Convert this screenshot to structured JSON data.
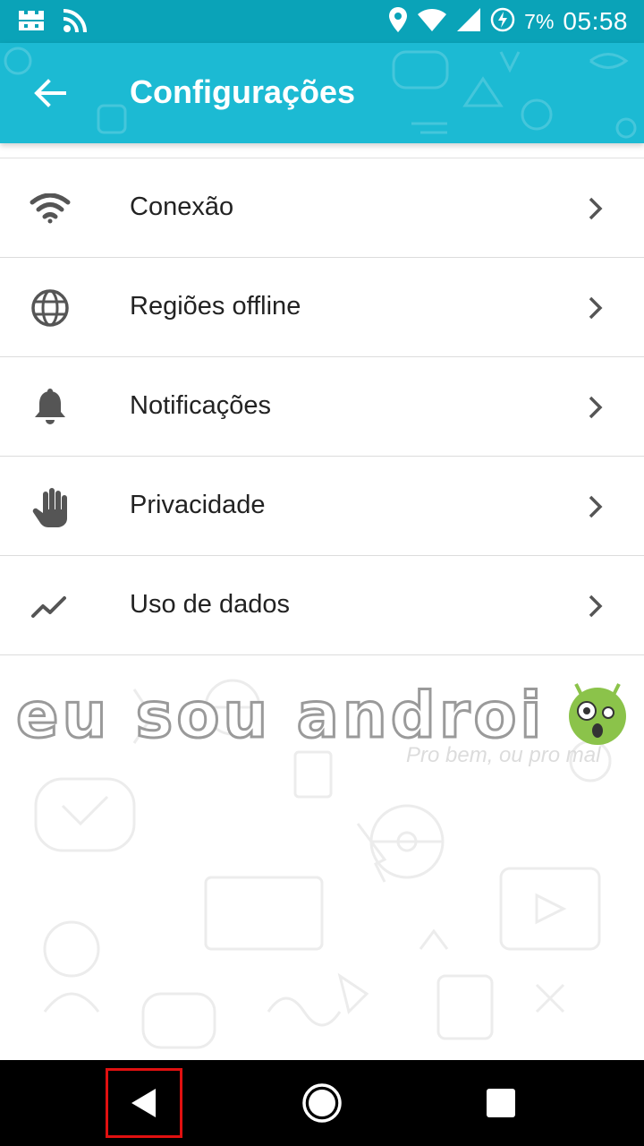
{
  "status_bar": {
    "icons_left": [
      "notification-app-icon",
      "cast-icon"
    ],
    "icons_right": [
      "location-icon",
      "wifi-icon",
      "signal-icon",
      "battery-charging-icon"
    ],
    "battery_percent": "7%",
    "time": "05:58"
  },
  "app_bar": {
    "title": "Configurações",
    "color": "#1cbad3"
  },
  "settings": {
    "items": [
      {
        "label": "Conexão",
        "icon": "wifi-icon"
      },
      {
        "label": "Regiões offline",
        "icon": "globe-icon"
      },
      {
        "label": "Notificações",
        "icon": "bell-icon"
      },
      {
        "label": "Privacidade",
        "icon": "hand-icon"
      },
      {
        "label": "Uso de dados",
        "icon": "trending-chart-icon"
      }
    ]
  },
  "watermark": {
    "brand": "eu sou androi",
    "tagline": "Pro bem, ou pro mal"
  },
  "nav_bar": {
    "buttons": [
      "back",
      "home",
      "recents"
    ],
    "highlight_color": "#e01010"
  }
}
